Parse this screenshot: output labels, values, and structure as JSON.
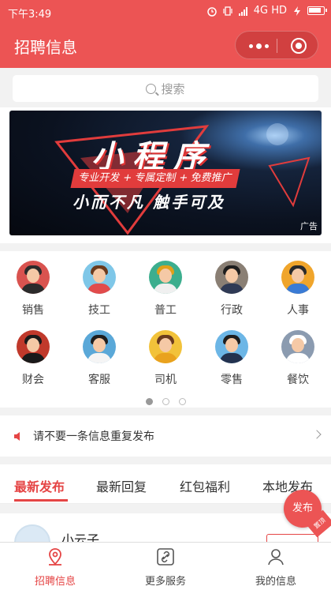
{
  "status": {
    "time": "下午3:49",
    "network": "4G HD"
  },
  "nav": {
    "title": "招聘信息"
  },
  "search": {
    "placeholder": "搜索"
  },
  "banner": {
    "headline": "小程序",
    "tags": "专业开发 + 专属定制 + 免费推广",
    "slogan": "小而不凡  触手可及",
    "ad_label": "广告"
  },
  "categories": [
    {
      "label": "销售",
      "icon": "salesman-avatar-icon",
      "bg": "#d9534f",
      "hair": "#2b2b2b",
      "body": "#2b2b2b"
    },
    {
      "label": "技工",
      "icon": "technician-avatar-icon",
      "bg": "#7fc7e8",
      "hair": "#6b3b1e",
      "body": "#e14b4b"
    },
    {
      "label": "普工",
      "icon": "worker-avatar-icon",
      "bg": "#3cae8e",
      "hair": "#e0a01a",
      "body": "#f0f0f0"
    },
    {
      "label": "行政",
      "icon": "admin-avatar-icon",
      "bg": "#8a7f74",
      "hair": "#1e1e1e",
      "body": "#2f3a55"
    },
    {
      "label": "人事",
      "icon": "hr-avatar-icon",
      "bg": "#f0a52b",
      "hair": "#2a2a2a",
      "body": "#3a7bd5"
    },
    {
      "label": "财会",
      "icon": "accountant-avatar-icon",
      "bg": "#c0392b",
      "hair": "#1a1a1a",
      "body": "#1a1a1a"
    },
    {
      "label": "客服",
      "icon": "service-avatar-icon",
      "bg": "#5aa8d8",
      "hair": "#1e1e1e",
      "body": "#f5f5f5"
    },
    {
      "label": "司机",
      "icon": "driver-avatar-icon",
      "bg": "#f2c23a",
      "hair": "#6b3b1e",
      "body": "#e9a21e"
    },
    {
      "label": "零售",
      "icon": "retail-avatar-icon",
      "bg": "#6cb6e6",
      "hair": "#1e1e1e",
      "body": "#23324f"
    },
    {
      "label": "餐饮",
      "icon": "chef-avatar-icon",
      "bg": "#8b9bb0",
      "hair": "#ffffff",
      "body": "#ffffff"
    }
  ],
  "carousel_dots": {
    "count": 3,
    "active": 0
  },
  "notice": {
    "text": "请不要一条信息重复发布"
  },
  "tabs": [
    {
      "label": "最新发布",
      "active": true
    },
    {
      "label": "最新回复",
      "active": false
    },
    {
      "label": "红包福利",
      "active": false
    },
    {
      "label": "本地发布",
      "active": false
    }
  ],
  "fab": {
    "label": "发布",
    "corner_tag": "置顶"
  },
  "post": {
    "name": "小云子"
  },
  "tabbar": [
    {
      "label": "招聘信息",
      "icon": "location-pin-icon",
      "active": true
    },
    {
      "label": "更多服务",
      "icon": "link-icon",
      "active": false
    },
    {
      "label": "我的信息",
      "icon": "person-icon",
      "active": false
    }
  ],
  "colors": {
    "accent": "#ec5454",
    "active_text": "#e54545"
  }
}
